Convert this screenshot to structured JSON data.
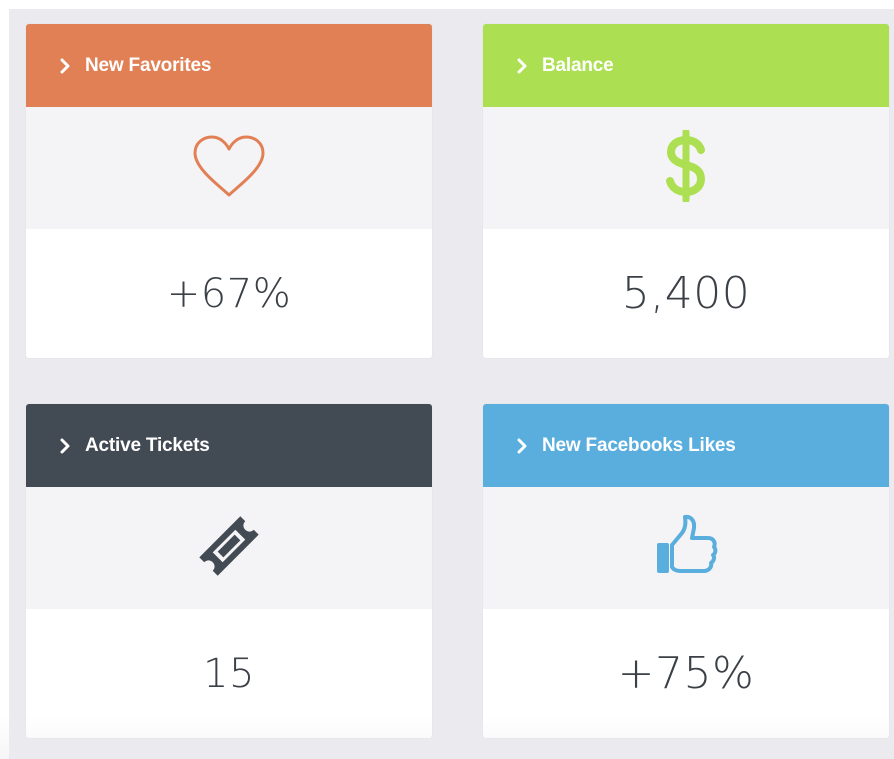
{
  "cards": [
    {
      "title": "New Favorites",
      "value": "+67%",
      "icon": "heart-icon",
      "color": "#e28055"
    },
    {
      "title": "Balance",
      "value": "5,400",
      "icon": "dollar-icon",
      "color": "#addf52"
    },
    {
      "title": "Active Tickets",
      "value": "15",
      "icon": "ticket-icon",
      "color": "#424a53"
    },
    {
      "title": "New Facebooks Likes",
      "value": "+75%",
      "icon": "thumbs-up-icon",
      "color": "#5aaede"
    }
  ]
}
